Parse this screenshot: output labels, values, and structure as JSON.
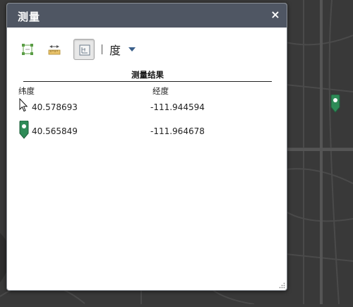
{
  "panel": {
    "title": "测量",
    "close_label": "×"
  },
  "toolbar": {
    "tools": [
      {
        "name": "area",
        "icon": "area-measure-icon",
        "active": false
      },
      {
        "name": "distance",
        "icon": "distance-measure-icon",
        "active": false
      },
      {
        "name": "location",
        "icon": "location-measure-icon",
        "active": true
      }
    ],
    "unit_selected": "度"
  },
  "results": {
    "title": "测量结果",
    "col_latitude": "纬度",
    "col_longitude": "经度",
    "rows": [
      {
        "icon": "cursor-icon",
        "latitude": "40.578693",
        "longitude": "-111.944594"
      },
      {
        "icon": "green-marker-icon",
        "latitude": "40.565849",
        "longitude": "-111.964678"
      }
    ]
  },
  "colors": {
    "header": "#4f5663",
    "marker": "#2e8b57",
    "map_background": "#3a3a3a"
  }
}
